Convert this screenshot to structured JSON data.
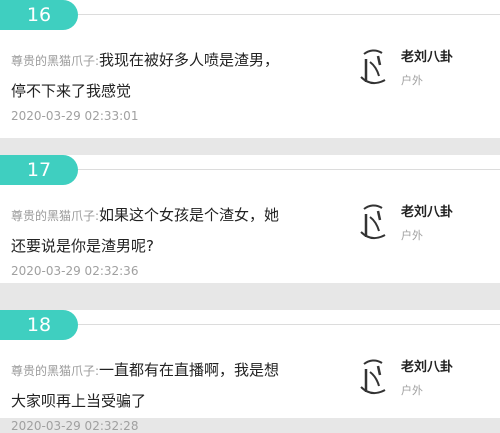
{
  "comments": [
    {
      "number": "16",
      "author": "尊贵的黑猫爪子:",
      "text_line1": "我现在被好多人喷是渣男，",
      "text_line2": "停不下来了我感觉",
      "time": "2020-03-29 02:33:01",
      "user_name": "老刘八卦",
      "user_sub": "户外"
    },
    {
      "number": "17",
      "author": "尊贵的黑猫爪子:",
      "text_line1": "如果这个女孩是个渣女，她",
      "text_line2": "还要说是你是渣男呢?",
      "time": "2020-03-29 02:32:36",
      "user_name": "老刘八卦",
      "user_sub": "户外"
    },
    {
      "number": "18",
      "author": "尊贵的黑猫爪子:",
      "text_line1": "一直都有在直播啊，我是想",
      "text_line2": "大家呗再上当受骗了",
      "time": "2020-03-29 02:32:28",
      "user_name": "老刘八卦",
      "user_sub": "户外"
    }
  ],
  "icons": {
    "avatar": "calligraphy-avatar-icon"
  },
  "colors": {
    "accent": "#3fcfc0",
    "background": "#e7e7e7"
  }
}
